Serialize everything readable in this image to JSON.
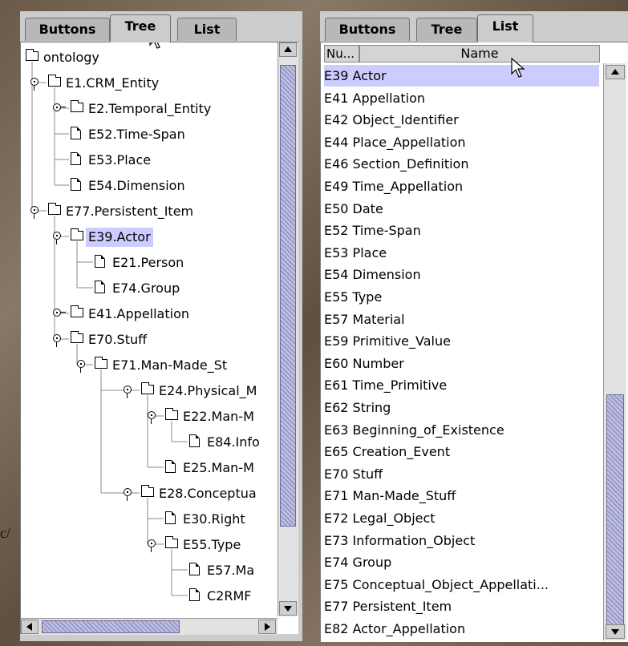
{
  "left_tabs": [
    "Buttons",
    "Tree",
    "List"
  ],
  "right_tabs": [
    "Buttons",
    "Tree",
    "List"
  ],
  "tree": [
    {
      "label": "ontology",
      "depth": 0,
      "icon": "folder",
      "handle": "none"
    },
    {
      "label": "E1.CRM_Entity",
      "depth": 1,
      "icon": "folder",
      "handle": "open"
    },
    {
      "label": "E2.Temporal_Entity",
      "depth": 2,
      "icon": "folder",
      "handle": "closed"
    },
    {
      "label": "E52.Time-Span",
      "depth": 2,
      "icon": "file",
      "handle": "none"
    },
    {
      "label": "E53.Place",
      "depth": 2,
      "icon": "file",
      "handle": "none"
    },
    {
      "label": "E54.Dimension",
      "depth": 2,
      "icon": "file",
      "handle": "none"
    },
    {
      "label": "E77.Persistent_Item",
      "depth": 1,
      "icon": "folder",
      "handle": "open"
    },
    {
      "label": "E39.Actor",
      "depth": 2,
      "icon": "folder",
      "handle": "open",
      "selected": true
    },
    {
      "label": "E21.Person",
      "depth": 3,
      "icon": "file",
      "handle": "none"
    },
    {
      "label": "E74.Group",
      "depth": 3,
      "icon": "file",
      "handle": "none"
    },
    {
      "label": "E41.Appellation",
      "depth": 2,
      "icon": "folder",
      "handle": "closed"
    },
    {
      "label": "E70.Stuff",
      "depth": 2,
      "icon": "folder",
      "handle": "open"
    },
    {
      "label": "E71.Man-Made_St",
      "depth": 3,
      "icon": "folder",
      "handle": "open"
    },
    {
      "label": "E24.Physical_M",
      "depth": 4,
      "icon": "folder",
      "handle": "open"
    },
    {
      "label": "E22.Man-M",
      "depth": 5,
      "icon": "folder",
      "handle": "open"
    },
    {
      "label": "E84.Info",
      "depth": 6,
      "icon": "file",
      "handle": "none"
    },
    {
      "label": "E25.Man-M",
      "depth": 5,
      "icon": "file",
      "handle": "none"
    },
    {
      "label": "E28.Conceptua",
      "depth": 4,
      "icon": "folder",
      "handle": "open"
    },
    {
      "label": "E30.Right",
      "depth": 5,
      "icon": "file",
      "handle": "none"
    },
    {
      "label": "E55.Type",
      "depth": 5,
      "icon": "folder",
      "handle": "open"
    },
    {
      "label": "E57.Ma",
      "depth": 6,
      "icon": "file",
      "handle": "none"
    },
    {
      "label": "C2RMF",
      "depth": 6,
      "icon": "file",
      "handle": "none"
    }
  ],
  "table": {
    "col_num": "Nu...",
    "col_name": "Name",
    "rows": [
      {
        "label": "E39 Actor",
        "selected": true
      },
      {
        "label": "E41 Appellation"
      },
      {
        "label": "E42 Object_Identifier"
      },
      {
        "label": "E44 Place_Appellation"
      },
      {
        "label": "E46 Section_Definition"
      },
      {
        "label": "E49 Time_Appellation"
      },
      {
        "label": "E50 Date"
      },
      {
        "label": "E52 Time-Span"
      },
      {
        "label": "E53 Place"
      },
      {
        "label": "E54 Dimension"
      },
      {
        "label": "E55 Type"
      },
      {
        "label": "E57 Material"
      },
      {
        "label": "E59 Primitive_Value"
      },
      {
        "label": "E60 Number"
      },
      {
        "label": "E61 Time_Primitive"
      },
      {
        "label": "E62 String"
      },
      {
        "label": "E63 Beginning_of_Existence"
      },
      {
        "label": "E65 Creation_Event"
      },
      {
        "label": "E70 Stuff"
      },
      {
        "label": "E71 Man-Made_Stuff"
      },
      {
        "label": "E72 Legal_Object"
      },
      {
        "label": "E73 Information_Object"
      },
      {
        "label": "E74 Group"
      },
      {
        "label": "E75 Conceptual_Object_Appellati..."
      },
      {
        "label": "E77 Persistent_Item"
      },
      {
        "label": "E82 Actor_Appellation"
      }
    ]
  },
  "stray_text": "c/",
  "colors": {
    "selection": "#ccccff",
    "panel": "#cccccc",
    "thumb": "#9a9ac8"
  }
}
